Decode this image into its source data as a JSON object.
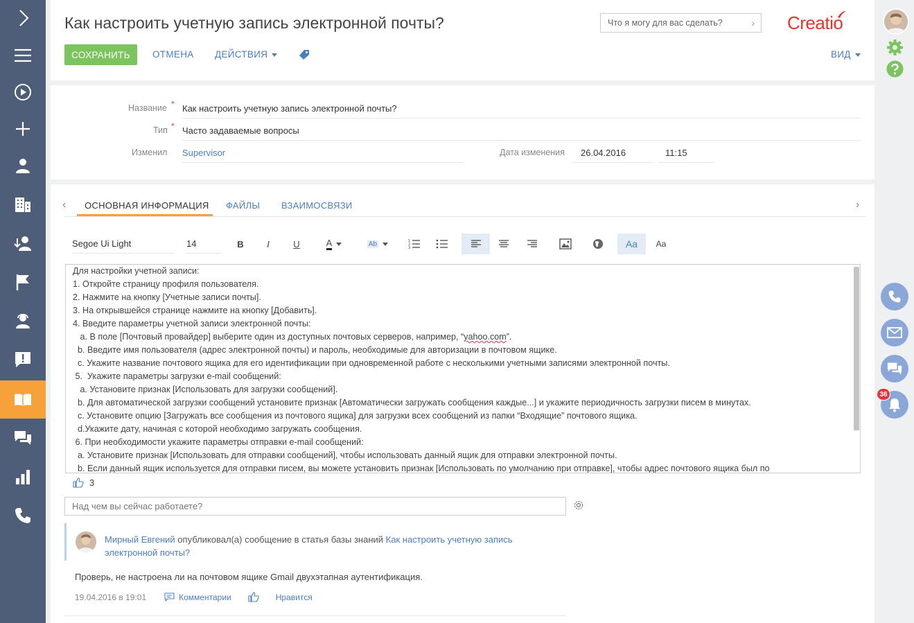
{
  "header": {
    "title": "Как настроить учетную запись электронной почты?",
    "search_placeholder": "Что я могу для вас сделать?",
    "logo": "Creatio"
  },
  "toolbar": {
    "save": "СОХРАНИТЬ",
    "cancel": "ОТМЕНА",
    "actions": "ДЕЙСТВИЯ",
    "view": "ВИД"
  },
  "fields": {
    "name_label": "Название",
    "name_value": "Как настроить учетную запись электронной почты?",
    "type_label": "Тип",
    "type_value": "Часто задаваемые вопросы",
    "modified_by_label": "Изменил",
    "modified_by_value": "Supervisor",
    "modified_date_label": "Дата изменения",
    "modified_date_value": "26.04.2016",
    "modified_time_value": "11:15"
  },
  "tabs": [
    {
      "label": "ОСНОВНАЯ ИНФОРМАЦИЯ",
      "active": true
    },
    {
      "label": "ФАЙЛЫ",
      "active": false
    },
    {
      "label": "ВЗАИМОСВЯЗИ",
      "active": false
    }
  ],
  "editor_toolbar": {
    "font_family": "Segoe Ui Light",
    "font_size": "14",
    "bold": "B",
    "italic": "I",
    "underline": "U",
    "font_color": "A",
    "highlight": "Ab",
    "case_upper": "Aa",
    "case_lower": "Aa"
  },
  "editor_lines": [
    "Для настройки учетной записи:",
    " 1. Откройте страницу профиля пользователя.",
    " 2. Нажмите на кнопку [Учетные записи почты].",
    " 3. На открывшейся странице нажмите на кнопку [Добавить].",
    " 4. Введите параметры учетной записи электронной почты:",
    "   a. В поле [Почтовый провайдер] выберите один из доступных почтовых серверов, например, “",
    "  b. Введите имя пользователя (адрес электронной почты) и пароль, необходимые для авторизации в почтовом ящике.",
    "  c. Укажите название почтового ящика для его идентификации при одновременной работе с несколькими учетными записями электронной почты.",
    " 5.  Укажите параметры загрузки e-mail сообщений:",
    "   a. Установите признак [Использовать для загрузки сообщений].",
    "  b. Для автоматической загрузки сообщений установите признак [Автоматически загружать сообщения каждые...] и укажите периодичность загрузки писем в минутах.",
    "  c. Установите опцию [Загружать все сообщения из почтового ящика] для загрузки всех сообщений из папки “Входящие” почтового ящика.",
    "  d.Укажите дату, начиная с которой необходимо загружать сообщения.",
    " 6. При необходимости укажите параметры отправки e-mail сообщений:",
    "  a. Установите признак [Использовать для отправки сообщений], чтобы использовать данный ящик для отправки электронной почты.",
    "  b. Если данный ящик используется для отправки писем, вы можете установить признак [Использовать по умолчанию при отправке], чтобы адрес почтового ящика был по"
  ],
  "editor_link_word": "yahoo.com",
  "editor_line5_tail": "”.",
  "likes": "3",
  "feed": {
    "placeholder": "Над чем вы сейчас работаете?",
    "author": "Мирный Евгений",
    "action": " опубликовал(а) сообщение в статья базы знаний ",
    "target": "Как настроить учетную запись электронной почты?",
    "body": "Проверь, не настроена ли на почтовом ящике Gmail двухэтапная аутентификация.",
    "date": "19.04.2016 в 19:01",
    "comments": "Комментарии",
    "like": "Нравится"
  },
  "notifications_count": "36",
  "colors": {
    "sidebar": "#4e5d78",
    "active": "#f7a13b",
    "save": "#7cc45e",
    "link": "#4a7fc1",
    "rail_button": "#8aa7d8"
  }
}
